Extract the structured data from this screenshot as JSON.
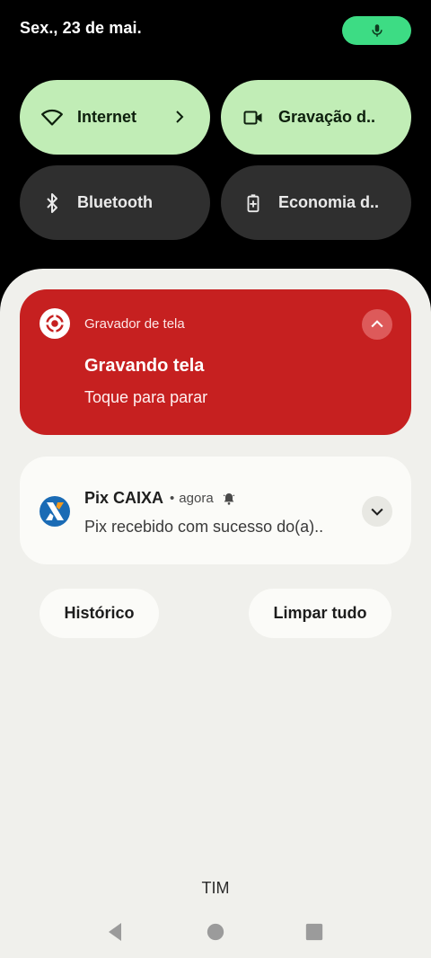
{
  "status_bar": {
    "date": "Sex., 23 de mai.",
    "mic_icon": "mic-icon",
    "accent": "#3ddc84"
  },
  "quick_settings": [
    {
      "label": "Internet",
      "icon": "wifi-icon",
      "active": true,
      "has_chevron": true
    },
    {
      "label": "Gravação d..",
      "icon": "screen-record-icon",
      "active": true,
      "has_chevron": false
    },
    {
      "label": "Bluetooth",
      "icon": "bluetooth-icon",
      "active": false,
      "has_chevron": false
    },
    {
      "label": "Economia d..",
      "icon": "battery-saver-icon",
      "active": false,
      "has_chevron": false
    }
  ],
  "notifications": {
    "recording": {
      "app": "Gravador de tela",
      "title": "Gravando tela",
      "text": "Toque para parar",
      "color": "#c62020"
    },
    "pix": {
      "app": "Pix CAIXA",
      "separator": "•",
      "time": "agora",
      "text": "Pix recebido com sucesso do(a)..",
      "icon_color": "#1a6bb5"
    }
  },
  "actions": {
    "history": "Histórico",
    "clear_all": "Limpar tudo"
  },
  "carrier": "TIM",
  "nav": [
    "back-icon",
    "home-icon",
    "recents-icon"
  ]
}
